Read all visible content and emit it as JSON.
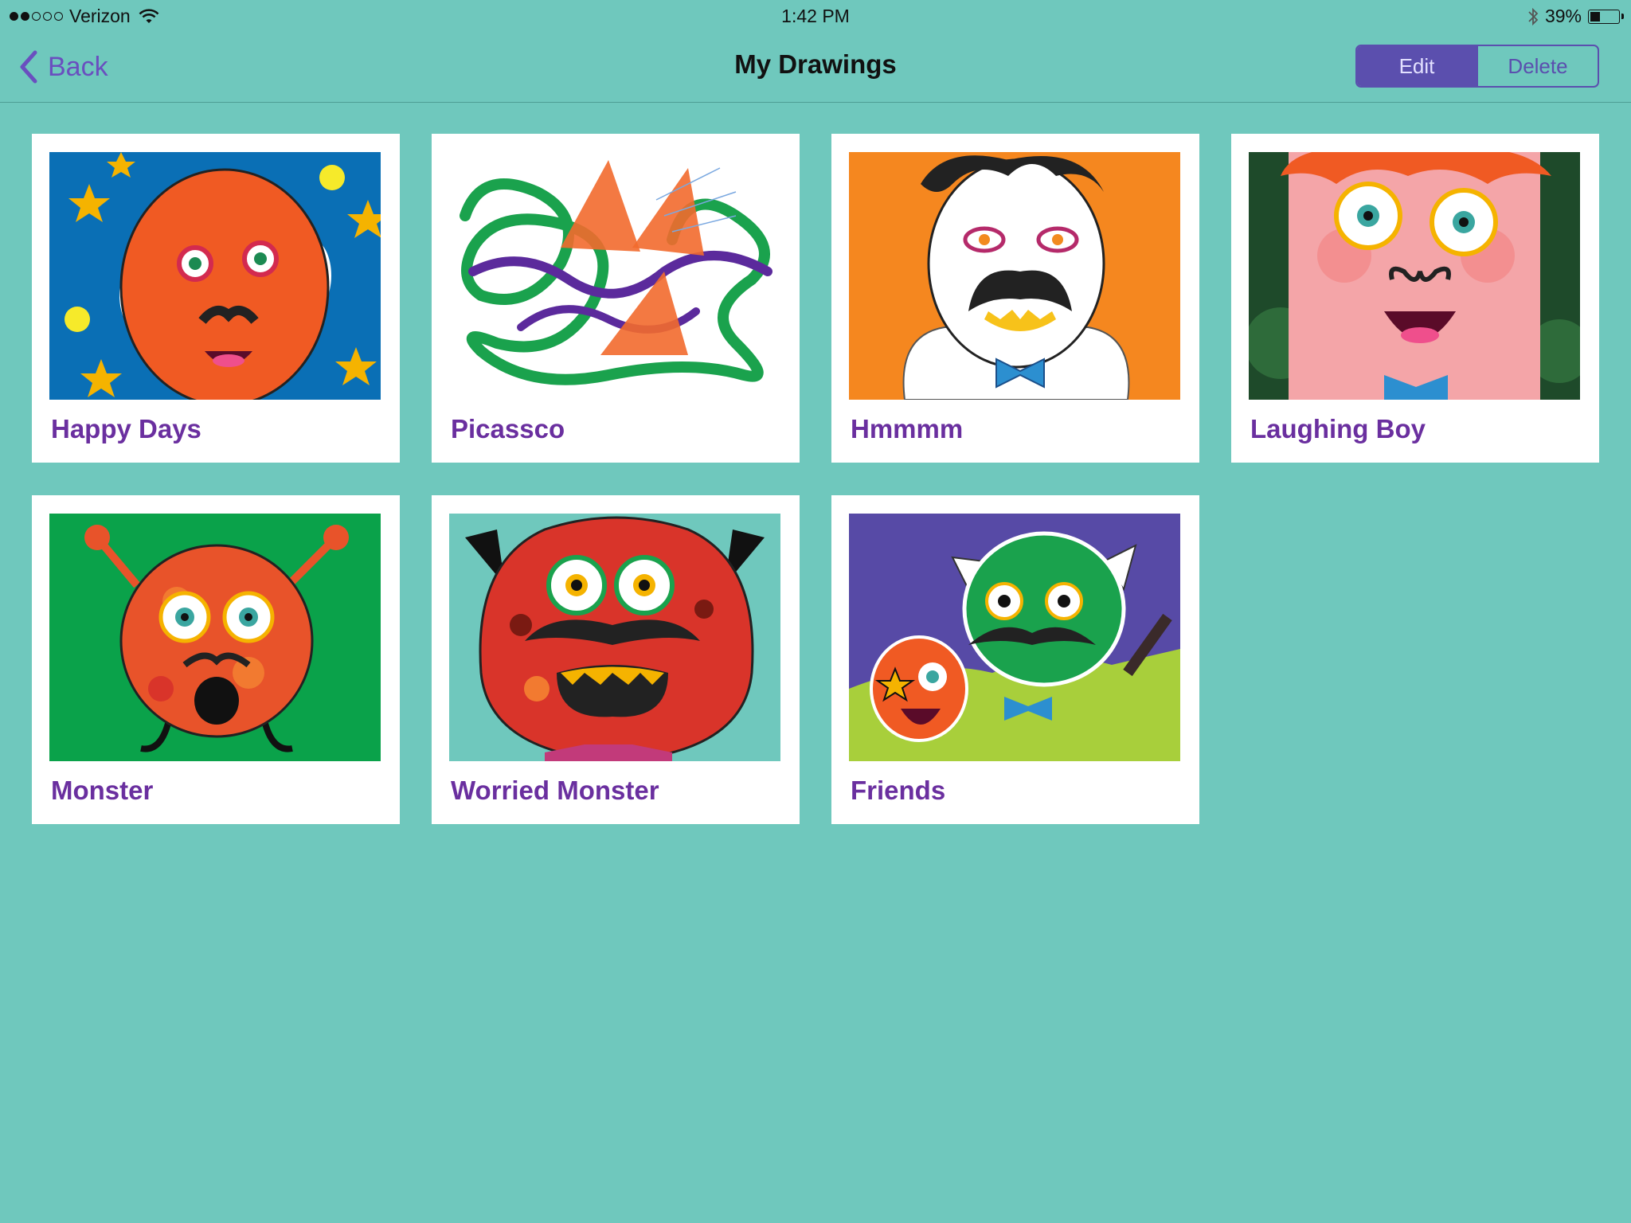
{
  "status_bar": {
    "carrier": "Verizon",
    "signal_bars": 2,
    "signal_total": 5,
    "time": "1:42 PM",
    "battery_percent": "39%",
    "battery_level": 0.39
  },
  "nav": {
    "back_label": "Back",
    "title": "My Drawings",
    "edit_label": "Edit",
    "delete_label": "Delete"
  },
  "drawings": [
    {
      "title": "Happy Days",
      "thumbnail": "orange-face-on-starry-blue"
    },
    {
      "title": "Picassco",
      "thumbnail": "green-purple-scribbles-with-orange-triangles"
    },
    {
      "title": "Hmmmm",
      "thumbnail": "mustached-man-on-orange"
    },
    {
      "title": "Laughing Boy",
      "thumbnail": "red-haired-boy-with-big-eyes"
    },
    {
      "title": "Monster",
      "thumbnail": "orange-spotted-monster-on-green"
    },
    {
      "title": "Worried Monster",
      "thumbnail": "red-horned-monster-with-mustache"
    },
    {
      "title": "Friends",
      "thumbnail": "green-and-orange-monsters-on-purple"
    }
  ],
  "colors": {
    "background": "#6fc8bd",
    "accent": "#5b4fae",
    "title_purple": "#6a2f9f"
  }
}
